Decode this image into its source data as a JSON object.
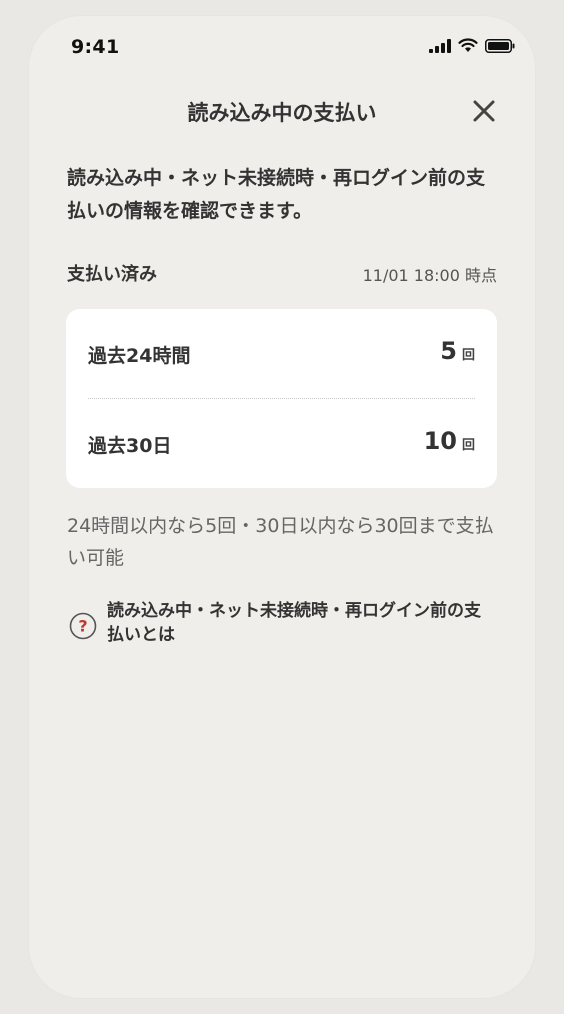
{
  "status_bar": {
    "time": "9:41",
    "icons": [
      "cellular-signal-icon",
      "wifi-icon",
      "battery-icon"
    ]
  },
  "header": {
    "title": "読み込み中の支払い",
    "close_icon": "close-icon"
  },
  "intro_text": "読み込み中・ネット未接続時・再ログイン前の支払いの情報を確認できます。",
  "section": {
    "title": "支払い済み",
    "as_of": "11/01 18:00 時点"
  },
  "summary": {
    "rows": [
      {
        "label": "過去24時間",
        "value": "5",
        "unit": "回"
      },
      {
        "label": "過去30日",
        "value": "10",
        "unit": "回"
      }
    ]
  },
  "note": "24時間以内なら5回・30日以内なら30回まで支払い可能",
  "help": {
    "icon": "question-circle-icon",
    "label": "読み込み中・ネット未接続時・再ログイン前の支払いとは"
  },
  "colors": {
    "background": "#e9e8e4",
    "screen": "#efeeea",
    "card": "#ffffff",
    "text": "#333333",
    "muted_text": "#666666",
    "help_icon_accent": "#c0392b"
  }
}
